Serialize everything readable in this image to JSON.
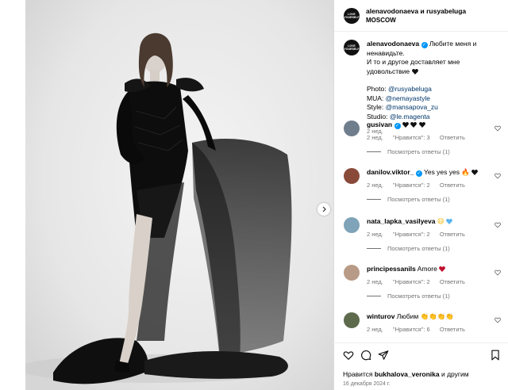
{
  "post": {
    "header_user": "alenavodonaeva и rusyabeluga",
    "header_location": "MOSCOW",
    "avatar_text": "LOVE YOURSELF"
  },
  "caption": {
    "username": "alenavodonaeva",
    "text_line1": "Любите меня и ненавидьте.",
    "text_line2": "И то и другое доставляет мне удовольствие",
    "photo_label": "Photo: ",
    "photo_link": "@rusyabeluga",
    "mua_label": "MUA: ",
    "mua_link": "@nemayastyle",
    "style_label": "Style: ",
    "style_link": "@mansapova_zu",
    "studio_label": "Studio: ",
    "studio_link": "@le.magenta",
    "time": "2 нед."
  },
  "comments": [
    {
      "username": "gusivan",
      "text": "",
      "time": "2 нед.",
      "likes": "\"Нравится\": 3",
      "reply": "Ответить",
      "view_replies": "Посмотреть ответы (1)",
      "verified": true,
      "avatar_color": "#6f7d8c"
    },
    {
      "username": "danilov.viktor_",
      "text": "Yes yes yes",
      "time": "2 нед.",
      "likes": "\"Нравится\": 2",
      "reply": "Ответить",
      "view_replies": "Посмотреть ответы (1)",
      "verified": true,
      "avatar_color": "#8a4a3a"
    },
    {
      "username": "nata_lapka_vasilyeva",
      "text": "",
      "time": "2 нед.",
      "likes": "\"Нравится\": 2",
      "reply": "Ответить",
      "view_replies": "Посмотреть ответы (1)",
      "verified": false,
      "avatar_color": "#7fa3b8"
    },
    {
      "username": "principessanils",
      "text": "Amore",
      "time": "2 нед.",
      "likes": "\"Нравится\": 2",
      "reply": "Ответить",
      "view_replies": "Посмотреть ответы (1)",
      "verified": false,
      "avatar_color": "#b89b86"
    },
    {
      "username": "winturov",
      "text": "Любим",
      "time": "2 нед.",
      "likes": "\"Нравится\": 6",
      "reply": "Ответить",
      "view_replies": "",
      "verified": false,
      "avatar_color": "#5d6a4c"
    }
  ],
  "footer": {
    "likes_prefix": "Нравится ",
    "likes_user": "bukhalova_veronika",
    "likes_suffix": " и другим",
    "date": "16 декабря 2024 г."
  },
  "colors": {
    "verified": "#0095f6",
    "link": "#00376b",
    "meta": "#737373"
  }
}
